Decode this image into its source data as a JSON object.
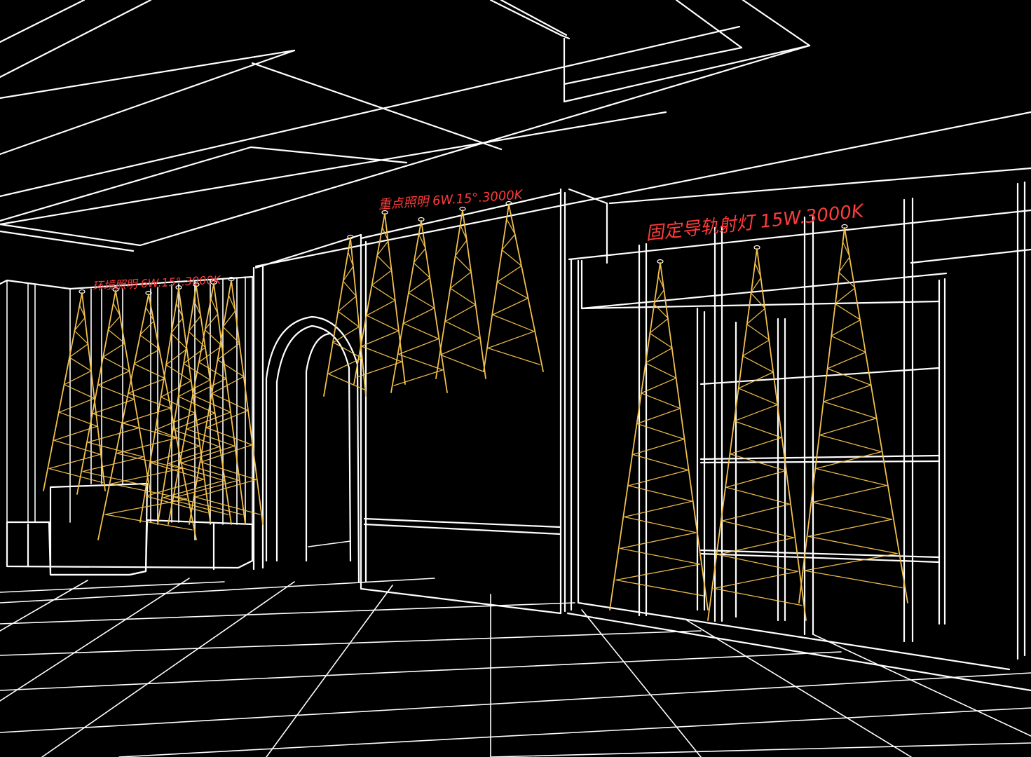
{
  "annotations": {
    "ambient": "环境照明 6W.15°.3000K",
    "accent": "重点照明 6W.15°.3000K",
    "track": "固定导轨射灯 15W.3000K"
  },
  "colors": {
    "background": "#000000",
    "linework": "#ffffff",
    "light_beam": "#f2c14e",
    "annotation": "#ff3b3b"
  },
  "icons": {
    "fixture": "downlight-icon",
    "beam": "light-cone-icon"
  }
}
